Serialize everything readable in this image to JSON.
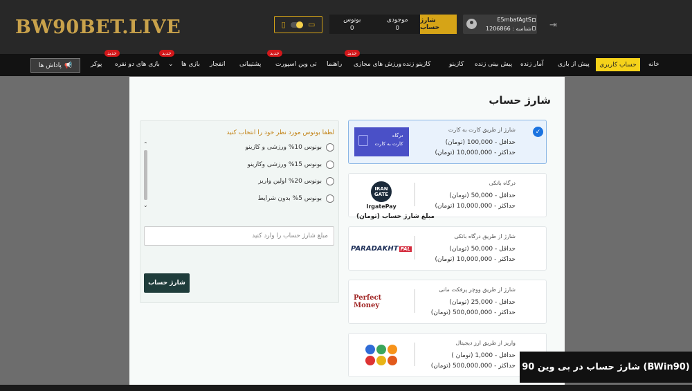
{
  "header": {
    "logo": "BW90BET.LIVE",
    "balance_label": "موجودی",
    "balance_value": "0",
    "bonus_label": "بونوس",
    "bonus_value": "0",
    "charge_label": "شارژ حساب",
    "username": "E5mbafAgtS",
    "user_id": "شناسه : 1206866"
  },
  "nav": {
    "account": "حساب کاربری",
    "items": [
      "خانه",
      "پیش از بازی",
      "آمار زنده",
      "پیش بینی زنده",
      "کازینو",
      "کازینو زنده",
      "ورزش های مجازی",
      "راهنما",
      "تی وین اسپورت",
      "پشتیبانی",
      "انفجار",
      "بازی ها",
      "بازی های دو نفره",
      "پوکر"
    ],
    "new_badge": "جدید",
    "reward": "پاداش ها"
  },
  "page": {
    "title": "شارژ حساب"
  },
  "methods": [
    {
      "title": "شارژ از طریق کارت به کارت",
      "min": "حداقل - 100,000 (تومان)",
      "max": "حداکثر - 10,000,000 (تومان)",
      "logo_line1": "درگاه",
      "logo_line2": "کارت به کارت",
      "selected": true
    },
    {
      "title": "درگاه بانکی",
      "min": "حداقل - 50,000 (تومان)",
      "max": "حداکثر - 10,000,000 (تومان)",
      "logo_text": "IRAN GATE",
      "logo_caption": "IrgatePay"
    },
    {
      "title": "شارژ از طریق درگاه بانکی",
      "min": "حداقل - 50,000 (تومان)",
      "max": "حداکثر - 10,000,000 (تومان)",
      "logo_text": "PARADAKHT",
      "logo_tag": "PAL"
    },
    {
      "title": "شارژ از طریق ووچر پرفکت مانی",
      "min": "حداقل - 25,000 (تومان)",
      "max": "حداکثر - 500,000,000 (تومان)",
      "logo_text": "Perfect Money"
    },
    {
      "title": "واریز از طریق ارز دیجیتال",
      "min": "حداقل - 1,000 (تومان )",
      "max": "حداکثر - 500,000,000 (تومان)"
    }
  ],
  "bonus": {
    "prompt": "لطفا بونوس مورد نظر خود را انتخاب کنید",
    "options": [
      "بونوس 10% ورزشی و کازینو",
      "بونوس 15% ورزشی وکازینو",
      "بونوس 20% اولین واریز",
      "بونوس 5% بدون شرایط"
    ],
    "amount_label": "مبلغ شارژ حساب (تومان)",
    "amount_placeholder": "مبلغ شارژ حساب را وارد کنید",
    "submit": "شارژ حساب"
  },
  "caption": "شارژ حساب در بی وین 90 (BWin90)",
  "colors": {
    "gold": "#d6a417",
    "accent_yellow": "#f5d21a",
    "dark_button": "#1f3d3b",
    "badge_red": "#d3171a",
    "selected_blue": "#1b73e0"
  }
}
